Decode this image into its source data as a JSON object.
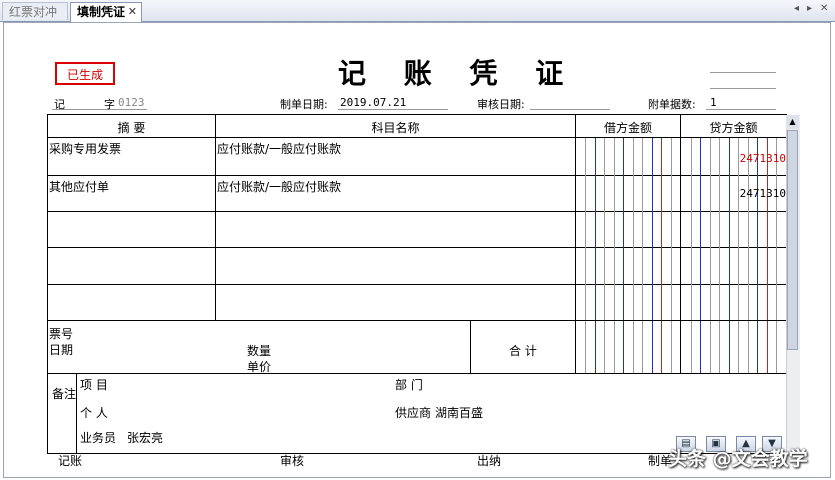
{
  "tabs": [
    {
      "label": "红票对冲",
      "active": false
    },
    {
      "label": "填制凭证",
      "active": true,
      "close": "✕"
    }
  ],
  "tab_controls": {
    "prev": "◂",
    "next": "▸",
    "close": "✕"
  },
  "voucher": {
    "stamp": "已生成",
    "title": "记 账 凭 证",
    "type_label": "记",
    "number_label": "字",
    "number_value": "0123",
    "date_label": "制单日期:",
    "date_value": "2019.07.21",
    "audit_date_label": "审核日期:",
    "attachment_label": "附单据数:",
    "attachment_value": "1"
  },
  "table": {
    "headers": {
      "summary": "摘 要",
      "account": "科目名称",
      "debit": "借方金额",
      "credit": "贷方金额"
    },
    "rows": [
      {
        "summary": "采购专用发票",
        "account": "应付账款/一般应付账款",
        "debit": "",
        "credit": "2471310",
        "credit_color": "#d00000"
      },
      {
        "summary": "其他应付单",
        "account": "应付账款/一般应付账款",
        "debit": "",
        "credit": "2471310",
        "credit_color": "#000000"
      },
      {
        "summary": "",
        "account": "",
        "debit": "",
        "credit": ""
      },
      {
        "summary": "",
        "account": "",
        "debit": "",
        "credit": ""
      },
      {
        "summary": "",
        "account": "",
        "debit": "",
        "credit": ""
      }
    ],
    "total_label": "合 计"
  },
  "detail": {
    "ticket_no_label": "票号",
    "date_label": "日期",
    "quantity_label": "数量",
    "unit_price_label": "单价"
  },
  "remarks": {
    "label": "备注",
    "project_label": "项 目",
    "department_label": "部 门",
    "person_label": "个 人",
    "supplier_label": "供应商",
    "supplier_value": "湖南百盛",
    "salesperson_label": "业务员",
    "salesperson_value": "张宏亮"
  },
  "footer": {
    "bookkeeper": "记账",
    "auditor": "审核",
    "cashier": "出纳",
    "preparer": "制单"
  },
  "watermark": "头条 @文会教学",
  "colors": {
    "blue_line": "#2030c0",
    "red_line": "#d02020",
    "gray_line": "#9a9a9a"
  }
}
